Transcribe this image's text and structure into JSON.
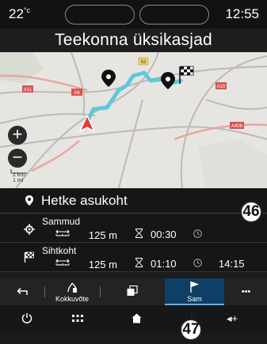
{
  "status": {
    "temperature": "22",
    "temperature_unit": "°c",
    "time": "12:55"
  },
  "screen_title": "Teekonna üksikasjad",
  "map": {
    "route_color": "#5ec8dc",
    "road_labels": [
      "53",
      "A6",
      "A11",
      "A10",
      "A406"
    ],
    "zoom_in_label": "+",
    "zoom_out_label": "−",
    "scale_text": "2 km",
    "scale_text_2": "1 mi"
  },
  "current_location": {
    "label": "Hetke asukoht",
    "icon": "location-pin-icon"
  },
  "route_rows": [
    {
      "icon": "waypoint-icon",
      "title": "Sammud",
      "distance": "125 m",
      "duration": "00:30",
      "arrival": ""
    },
    {
      "icon": "checkered-flag-icon",
      "title": "Sihtkoht",
      "distance": "125 m",
      "duration": "01:10",
      "arrival": "14:15"
    }
  ],
  "toolbar": {
    "back_icon": "back-icon",
    "summary_label": "Kokkuvõte",
    "pages_icon": "pages-icon",
    "steps_label": "Sam",
    "more_label": "•••"
  },
  "bottom_nav": {
    "power_icon": "power-icon",
    "apps_icon": "apps-grid-icon",
    "home_icon": "home-icon",
    "volume_label": "◂+"
  },
  "callouts": {
    "a": "46",
    "b": "47"
  },
  "colors": {
    "accent": "#5ab0ff",
    "active_tab": "#0e3f66",
    "background": "#161616"
  }
}
